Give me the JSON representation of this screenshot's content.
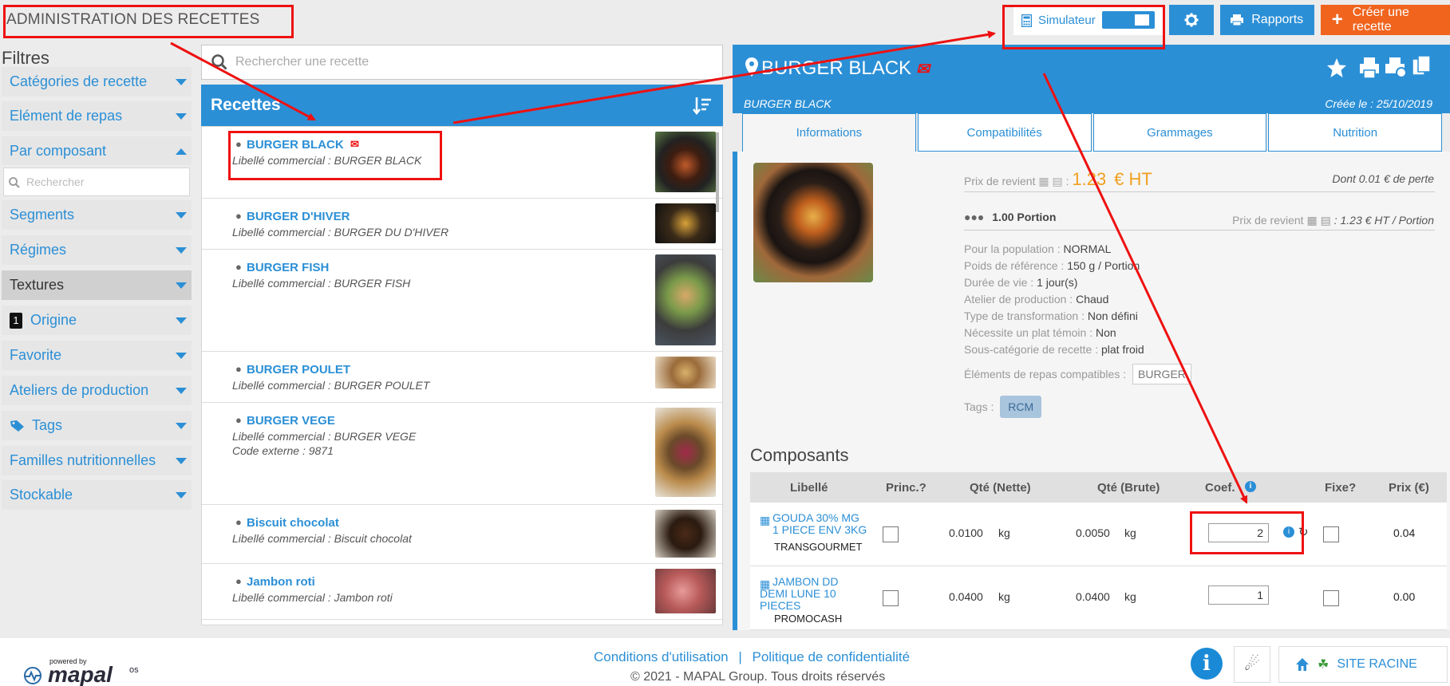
{
  "app": {
    "title": "ADMINISTRATION DES RECETTES"
  },
  "toolbar": {
    "simulator_label": "Simulateur",
    "reports_label": "Rapports",
    "create_label": "Créer une recette"
  },
  "filters": {
    "title": "Filtres",
    "search_placeholder": "Rechercher",
    "items": [
      {
        "label": "Catégories de recette"
      },
      {
        "label": "Elément de repas"
      },
      {
        "label": "Par composant"
      },
      {
        "label": "Segments"
      },
      {
        "label": "Régimes"
      },
      {
        "label": "Textures"
      },
      {
        "label": "Origine",
        "badge": "1"
      },
      {
        "label": "Favorite"
      },
      {
        "label": "Ateliers de production"
      },
      {
        "label": "Tags"
      },
      {
        "label": "Familles nutritionnelles"
      },
      {
        "label": "Stockable"
      }
    ]
  },
  "recipes": {
    "search_placeholder": "Rechercher une recette",
    "header": "Recettes",
    "items": [
      {
        "name": "BURGER BLACK",
        "lines": [
          "Libellé commercial : BURGER BLACK"
        ]
      },
      {
        "name": "BURGER D'HIVER",
        "lines": [
          "Libellé commercial : BURGER DU D'HIVER"
        ]
      },
      {
        "name": "BURGER FISH",
        "lines": [
          "Libellé commercial : BURGER FISH"
        ]
      },
      {
        "name": "BURGER POULET",
        "lines": [
          "Libellé commercial : BURGER POULET"
        ]
      },
      {
        "name": "BURGER VEGE",
        "lines": [
          "Libellé commercial : BURGER VEGE",
          "Code externe : 9871"
        ]
      },
      {
        "name": "Biscuit chocolat",
        "lines": [
          "Libellé commercial : Biscuit chocolat"
        ]
      },
      {
        "name": "Jambon roti",
        "lines": [
          "Libellé commercial : Jambon roti"
        ]
      }
    ]
  },
  "detail": {
    "title": "BURGER BLACK",
    "subtitle": "BURGER BLACK",
    "created": "Créée le : 25/10/2019",
    "tabs": [
      "Informations",
      "Compatibilités",
      "Grammages",
      "Nutrition"
    ],
    "cost_label": "Prix de revient",
    "cost_value": "1.23",
    "cost_unit": "€ HT",
    "loss": "Dont 0.01 € de perte",
    "portion": "1.00 Portion",
    "portion_cost_label": "Prix de revient",
    "portion_cost_value": ": 1.23 € HT / Portion",
    "info": [
      {
        "label": "Pour la population :",
        "value": "NORMAL"
      },
      {
        "label": "Poids de référence :",
        "value": "150 g / Portion"
      },
      {
        "label": "Durée de vie :",
        "value": "1 jour(s)"
      },
      {
        "label": "Atelier de production :",
        "value": "Chaud"
      },
      {
        "label": "Type de transformation :",
        "value": "Non défini"
      },
      {
        "label": "Nécessite un plat témoin :",
        "value": "Non"
      },
      {
        "label": "Sous-catégorie de recette :",
        "value": "plat froid"
      }
    ],
    "compatible_label": "Éléments de repas compatibles :",
    "compatible_value": "BURGER",
    "tags_label": "Tags :",
    "tags_value": "RCM"
  },
  "components": {
    "title": "Composants",
    "headers": {
      "label": "Libellé",
      "princ": "Princ.?",
      "qty_net": "Qté (Nette)",
      "qty_gross": "Qté (Brute)",
      "coef": "Coef.",
      "fixed": "Fixe?",
      "price": "Prix (€)"
    },
    "rows": [
      {
        "name": "GOUDA 30% MG 1 PIECE ENV 3KG",
        "supplier": "TRANSGOURMET",
        "net": "0.0100",
        "net_unit": "kg",
        "gross": "0.0050",
        "gross_unit": "kg",
        "coef": "2",
        "price": "0.04"
      },
      {
        "name": "JAMBON DD DEMI LUNE 10 PIECES",
        "supplier": "PROMOCASH",
        "net": "0.0400",
        "net_unit": "kg",
        "gross": "0.0400",
        "gross_unit": "kg",
        "coef": "1",
        "price": "0.00"
      }
    ]
  },
  "footer": {
    "powered_by": "powered by",
    "brand": "mapal",
    "brand_suffix": "os",
    "terms": "Conditions d'utilisation",
    "separator": "|",
    "privacy": "Politique de confidentialité",
    "copyright": "© 2021 - MAPAL Group. Tous droits réservés",
    "site_label": "SITE RACINE"
  },
  "colors": {
    "accent": "#2b8fd6",
    "orange": "#f0641e",
    "annotation": "#e11111"
  }
}
